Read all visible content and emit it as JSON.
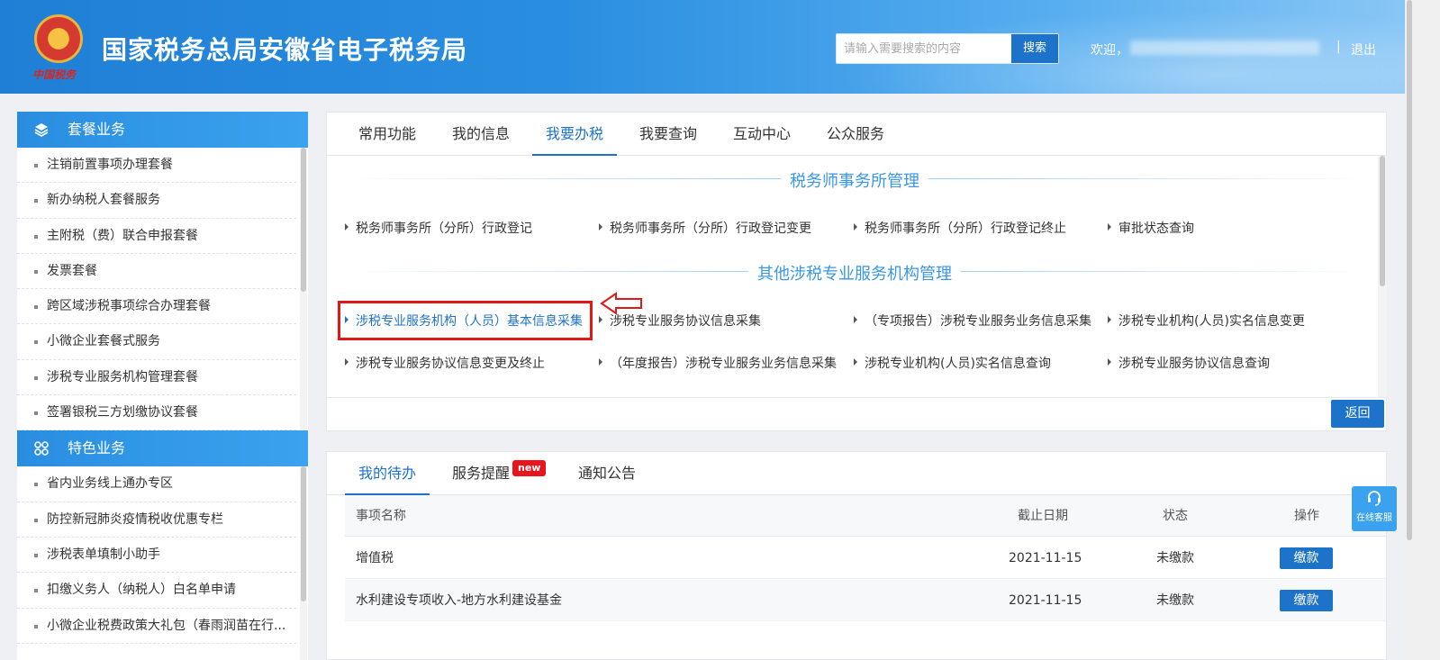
{
  "header": {
    "emblem_text": "中国税务",
    "title": "国家税务总局安徽省电子税务局",
    "search_placeholder": "请输入需要搜索的内容",
    "search_button": "搜索",
    "welcome": "欢迎，",
    "separator": "|",
    "logout": "退出"
  },
  "sidebar": {
    "sections": [
      {
        "title": "套餐业务",
        "icon": "layers-icon",
        "items": [
          "注销前置事项办理套餐",
          "新办纳税人套餐服务",
          "主附税（费）联合申报套餐",
          "发票套餐",
          "跨区域涉税事项综合办理套餐",
          "小微企业套餐式服务",
          "涉税专业服务机构管理套餐",
          "签署银税三方划缴协议套餐"
        ]
      },
      {
        "title": "特色业务",
        "icon": "grid-icon",
        "items": [
          "省内业务线上通办专区",
          "防控新冠肺炎疫情税收优惠专栏",
          "涉税表单填制小助手",
          "扣缴义务人（纳税人）白名单申请",
          "小微企业税费政策大礼包（春雨润苗在行..."
        ]
      }
    ]
  },
  "main": {
    "tabs": [
      "常用功能",
      "我的信息",
      "我要办税",
      "我要查询",
      "互动中心",
      "公众服务"
    ],
    "active_tab": "我要办税",
    "section1": {
      "title": "税务师事务所管理",
      "links": [
        "税务师事务所（分所）行政登记",
        "税务师事务所（分所）行政登记变更",
        "税务师事务所（分所）行政登记终止",
        "审批状态查询"
      ]
    },
    "section2": {
      "title": "其他涉税专业服务机构管理",
      "links": [
        "涉税专业服务机构（人员）基本信息采集",
        "涉税专业服务协议信息采集",
        "（专项报告）涉税专业服务业务信息采集",
        "涉税专业机构(人员)实名信息变更",
        "涉税专业服务协议信息变更及终止",
        "（年度报告）涉税专业服务业务信息采集",
        "涉税专业机构(人员)实名信息查询",
        "涉税专业服务协议信息查询"
      ]
    },
    "back_button": "返回"
  },
  "todo": {
    "tabs": [
      "我的待办",
      "服务提醒",
      "通知公告"
    ],
    "new_badge": "new",
    "columns": [
      "事项名称",
      "截止日期",
      "状态",
      "操作"
    ],
    "rows": [
      {
        "name": "增值税",
        "deadline": "2021-11-15",
        "status": "未缴款",
        "action": "缴款"
      },
      {
        "name": "水利建设专项收入-地方水利建设基金",
        "deadline": "2021-11-15",
        "status": "未缴款",
        "action": "缴款"
      }
    ]
  },
  "customer_service": {
    "label": "在线客服",
    "icon": "headset-icon"
  }
}
